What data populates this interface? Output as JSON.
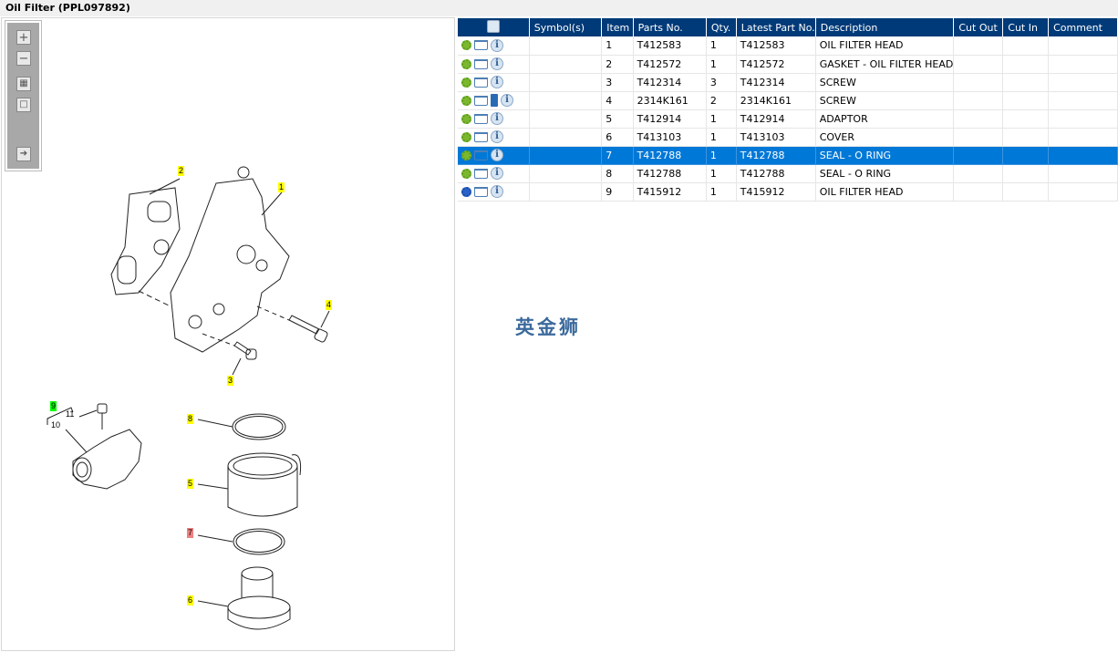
{
  "window": {
    "title": "Oil Filter (PPL097892)"
  },
  "toolbar": {
    "buttons": [
      {
        "name": "zoom-in",
        "icon": "plus-icon"
      },
      {
        "name": "zoom-out",
        "icon": "minus-icon"
      },
      {
        "name": "fit-all",
        "icon": "grid-icon"
      },
      {
        "name": "fit-page",
        "icon": "square-icon"
      },
      {
        "name": "export",
        "icon": "export-arrow-icon"
      }
    ]
  },
  "diagram": {
    "callouts": [
      {
        "label": "2",
        "color": "yellow"
      },
      {
        "label": "1",
        "color": "yellow"
      },
      {
        "label": "4",
        "color": "yellow"
      },
      {
        "label": "3",
        "color": "yellow"
      },
      {
        "label": "9",
        "color": "green"
      },
      {
        "label": "11",
        "color": "none"
      },
      {
        "label": "10",
        "color": "none"
      },
      {
        "label": "8",
        "color": "yellow"
      },
      {
        "label": "5",
        "color": "yellow"
      },
      {
        "label": "7",
        "color": "red"
      },
      {
        "label": "6",
        "color": "yellow"
      }
    ]
  },
  "table": {
    "columns": [
      "",
      "Symbol(s)",
      "Item",
      "Parts No.",
      "Qty.",
      "Latest Part No.",
      "Description",
      "Cut Out",
      "Cut In",
      "Comment"
    ],
    "selected_item": "7",
    "rows": [
      {
        "icons": [
          "gear",
          "cart",
          "info"
        ],
        "item": "1",
        "part": "T412583",
        "qty": "1",
        "latest": "T412583",
        "desc": "OIL FILTER HEAD"
      },
      {
        "icons": [
          "gear",
          "cart",
          "info"
        ],
        "item": "2",
        "part": "T412572",
        "qty": "1",
        "latest": "T412572",
        "desc": "GASKET - OIL FILTER HEAD"
      },
      {
        "icons": [
          "gear",
          "cart",
          "info"
        ],
        "item": "3",
        "part": "T412314",
        "qty": "3",
        "latest": "T412314",
        "desc": "SCREW"
      },
      {
        "icons": [
          "gear",
          "cart",
          "book",
          "info"
        ],
        "item": "4",
        "part": "2314K161",
        "qty": "2",
        "latest": "2314K161",
        "desc": "SCREW"
      },
      {
        "icons": [
          "gear",
          "cart",
          "info"
        ],
        "item": "5",
        "part": "T412914",
        "qty": "1",
        "latest": "T412914",
        "desc": "ADAPTOR"
      },
      {
        "icons": [
          "gear",
          "cart",
          "info"
        ],
        "item": "6",
        "part": "T413103",
        "qty": "1",
        "latest": "T413103",
        "desc": "COVER"
      },
      {
        "icons": [
          "gear",
          "cart",
          "info"
        ],
        "item": "7",
        "part": "T412788",
        "qty": "1",
        "latest": "T412788",
        "desc": "SEAL - O RING"
      },
      {
        "icons": [
          "gear",
          "cart",
          "info"
        ],
        "item": "8",
        "part": "T412788",
        "qty": "1",
        "latest": "T412788",
        "desc": "SEAL - O RING"
      },
      {
        "icons": [
          "gear-multi",
          "cart",
          "info"
        ],
        "item": "9",
        "part": "T415912",
        "qty": "1",
        "latest": "T415912",
        "desc": "OIL FILTER HEAD"
      }
    ]
  },
  "watermark": "英金狮",
  "colors": {
    "header": "#003a78",
    "selected": "#0078d7",
    "callout_yellow": "#ffff00",
    "callout_green": "#00ff00",
    "callout_red": "#f08080"
  }
}
